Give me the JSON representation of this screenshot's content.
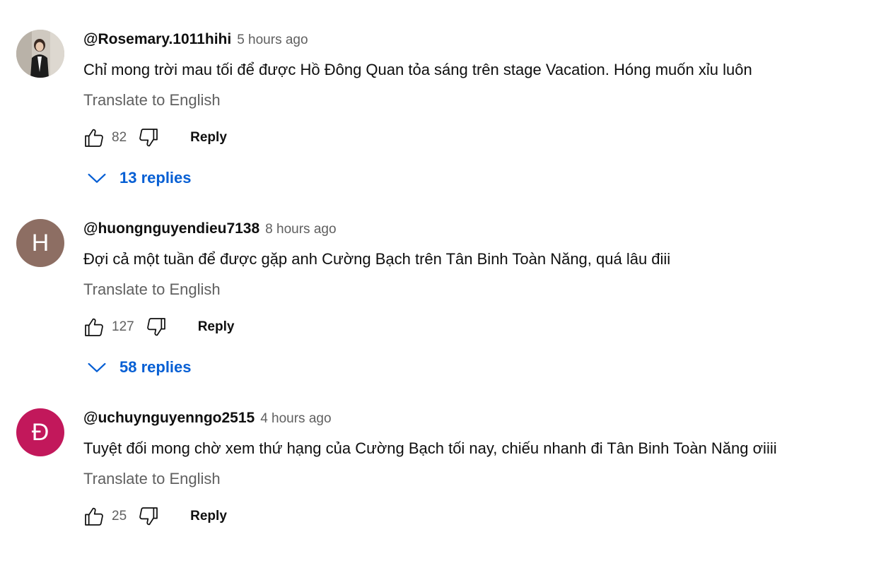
{
  "comments": [
    {
      "author": "@Rosemary.1011hihi",
      "time": "5 hours ago",
      "text": "Chỉ mong trời mau tối để được Hồ Đông Quan tỏa sáng trên stage Vacation. Hóng muốn xỉu luôn",
      "translate_label": "Translate to English",
      "likes": "82",
      "reply_label": "Reply",
      "replies_label": "13 replies",
      "avatar_type": "photo",
      "avatar_letter": "",
      "avatar_color": "#cfc9c0"
    },
    {
      "author": "@huongnguyendieu7138",
      "time": "8 hours ago",
      "text": "Đợi cả một tuần để được gặp anh Cường Bạch trên Tân Binh Toàn Năng, quá lâu điii",
      "translate_label": "Translate to English",
      "likes": "127",
      "reply_label": "Reply",
      "replies_label": "58 replies",
      "avatar_type": "letter",
      "avatar_letter": "H",
      "avatar_color": "#8d6e63"
    },
    {
      "author": "@uchuynguyenngo2515",
      "time": "4 hours ago",
      "text": "Tuyệt đối mong chờ xem thứ hạng của Cường Bạch tối nay, chiếu nhanh đi Tân Binh Toàn Năng ơiiii",
      "translate_label": "Translate to English",
      "likes": "25",
      "reply_label": "Reply",
      "replies_label": "",
      "avatar_type": "letter",
      "avatar_letter": "Đ",
      "avatar_color": "#c2185b"
    }
  ],
  "colors": {
    "accent_link": "#065fd4",
    "secondary_text": "#606060",
    "primary_text": "#0f0f0f"
  },
  "icons": {
    "like": "thumbs-up-icon",
    "dislike": "thumbs-down-icon",
    "expand": "chevron-down-icon"
  }
}
